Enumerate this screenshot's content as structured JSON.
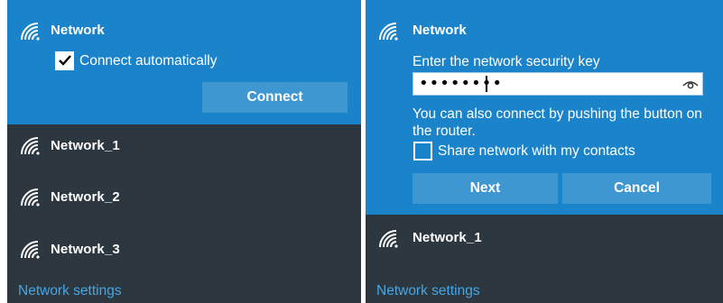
{
  "left_panel": {
    "header": {
      "network_name": "Network",
      "connect_auto_label": "Connect automatically",
      "connect_auto_checked": true,
      "connect_button": "Connect"
    },
    "networks": [
      {
        "name": "Network_1"
      },
      {
        "name": "Network_2"
      },
      {
        "name": "Network_3"
      }
    ],
    "settings_link": "Network settings"
  },
  "right_panel": {
    "header": {
      "network_name": "Network",
      "key_prompt": "Enter the network security key",
      "password_value": "••••••••",
      "router_hint_line1": "You can also connect by pushing the button on",
      "router_hint_line2": "the router.",
      "share_label": "Share network with my contacts",
      "share_checked": false,
      "next_button": "Next",
      "cancel_button": "Cancel"
    },
    "networks": [
      {
        "name": "Network_1"
      }
    ],
    "settings_link": "Network settings"
  },
  "colors": {
    "accent_blue": "#1b83c9",
    "panel_dark": "#2c373f",
    "link_blue": "#46a6e6"
  },
  "icons": {
    "wifi": "wifi-signal-icon",
    "checkmark": "checkmark-icon",
    "reveal_password": "eye-icon"
  }
}
